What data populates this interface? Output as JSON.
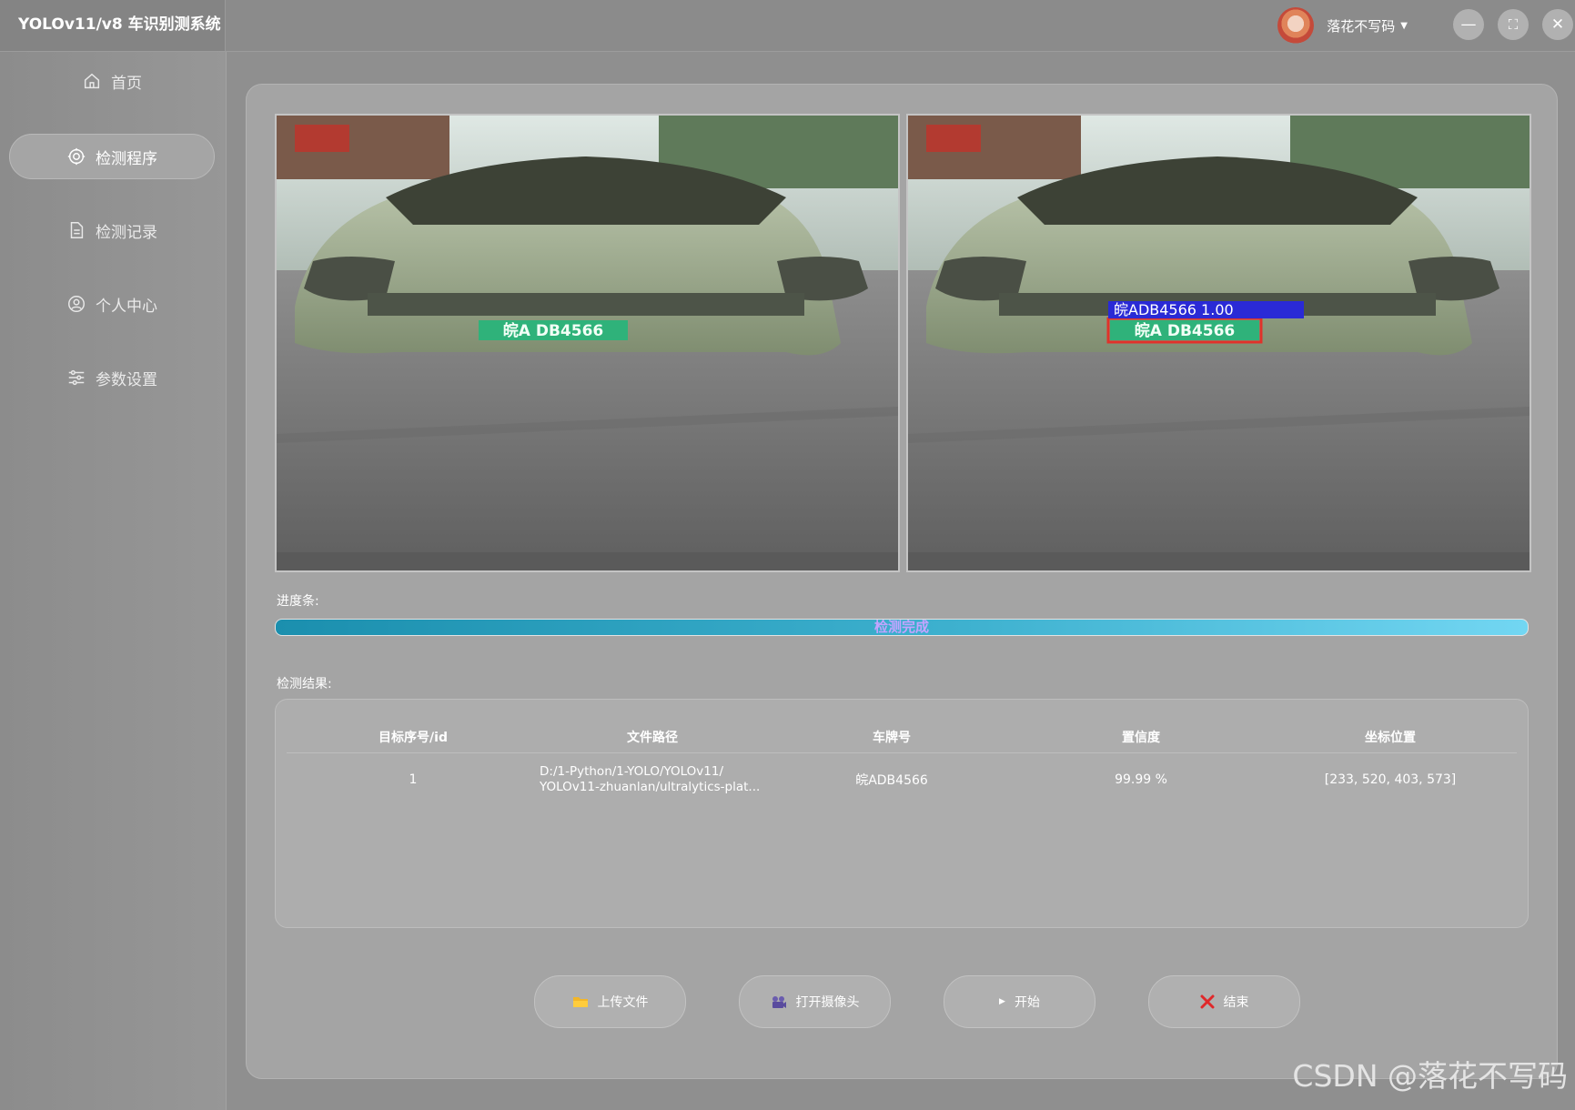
{
  "app": {
    "title": "YOLOv11/v8 车识别测系统"
  },
  "user": {
    "name": "落花不写码"
  },
  "window_controls": {
    "minimize": "—",
    "maximize": "⛶",
    "close": "✕"
  },
  "sidebar": {
    "items": [
      {
        "label": "首页",
        "icon": "home-icon",
        "active": false
      },
      {
        "label": "检测程序",
        "icon": "detect-icon",
        "active": true
      },
      {
        "label": "检测记录",
        "icon": "document-icon",
        "active": false
      },
      {
        "label": "个人中心",
        "icon": "user-icon",
        "active": false
      },
      {
        "label": "参数设置",
        "icon": "sliders-icon",
        "active": false
      }
    ]
  },
  "images": {
    "source": {
      "plate_text": "皖A DB4566"
    },
    "result": {
      "plate_text": "皖A DB4566",
      "detection_label": "皖ADB4566 1.00"
    }
  },
  "progress": {
    "label": "进度条:",
    "status": "检测完成",
    "value": 100,
    "colors": {
      "start": "#1b8fae",
      "end": "#72d6f2",
      "text": "#c4a4ff"
    }
  },
  "results": {
    "label": "检测结果:",
    "headers": [
      "目标序号/id",
      "文件路径",
      "车牌号",
      "置信度",
      "坐标位置"
    ],
    "rows": [
      {
        "id": "1",
        "path_line1": "D:/1-Python/1-YOLO/YOLOv11/",
        "path_line2": "YOLOv11-zhuanlan/ultralytics-plat...",
        "plate": "皖ADB4566",
        "confidence": "99.99 %",
        "coords": "[233, 520, 403, 573]"
      }
    ]
  },
  "actions": {
    "upload": {
      "label": "上传文件",
      "icon": "folder-icon"
    },
    "camera": {
      "label": "打开摄像头",
      "icon": "camera-icon"
    },
    "start": {
      "label": "开始",
      "icon": "play-icon"
    },
    "stop": {
      "label": "结束",
      "icon": "close-icon"
    }
  },
  "watermark": "CSDN @落花不写码"
}
